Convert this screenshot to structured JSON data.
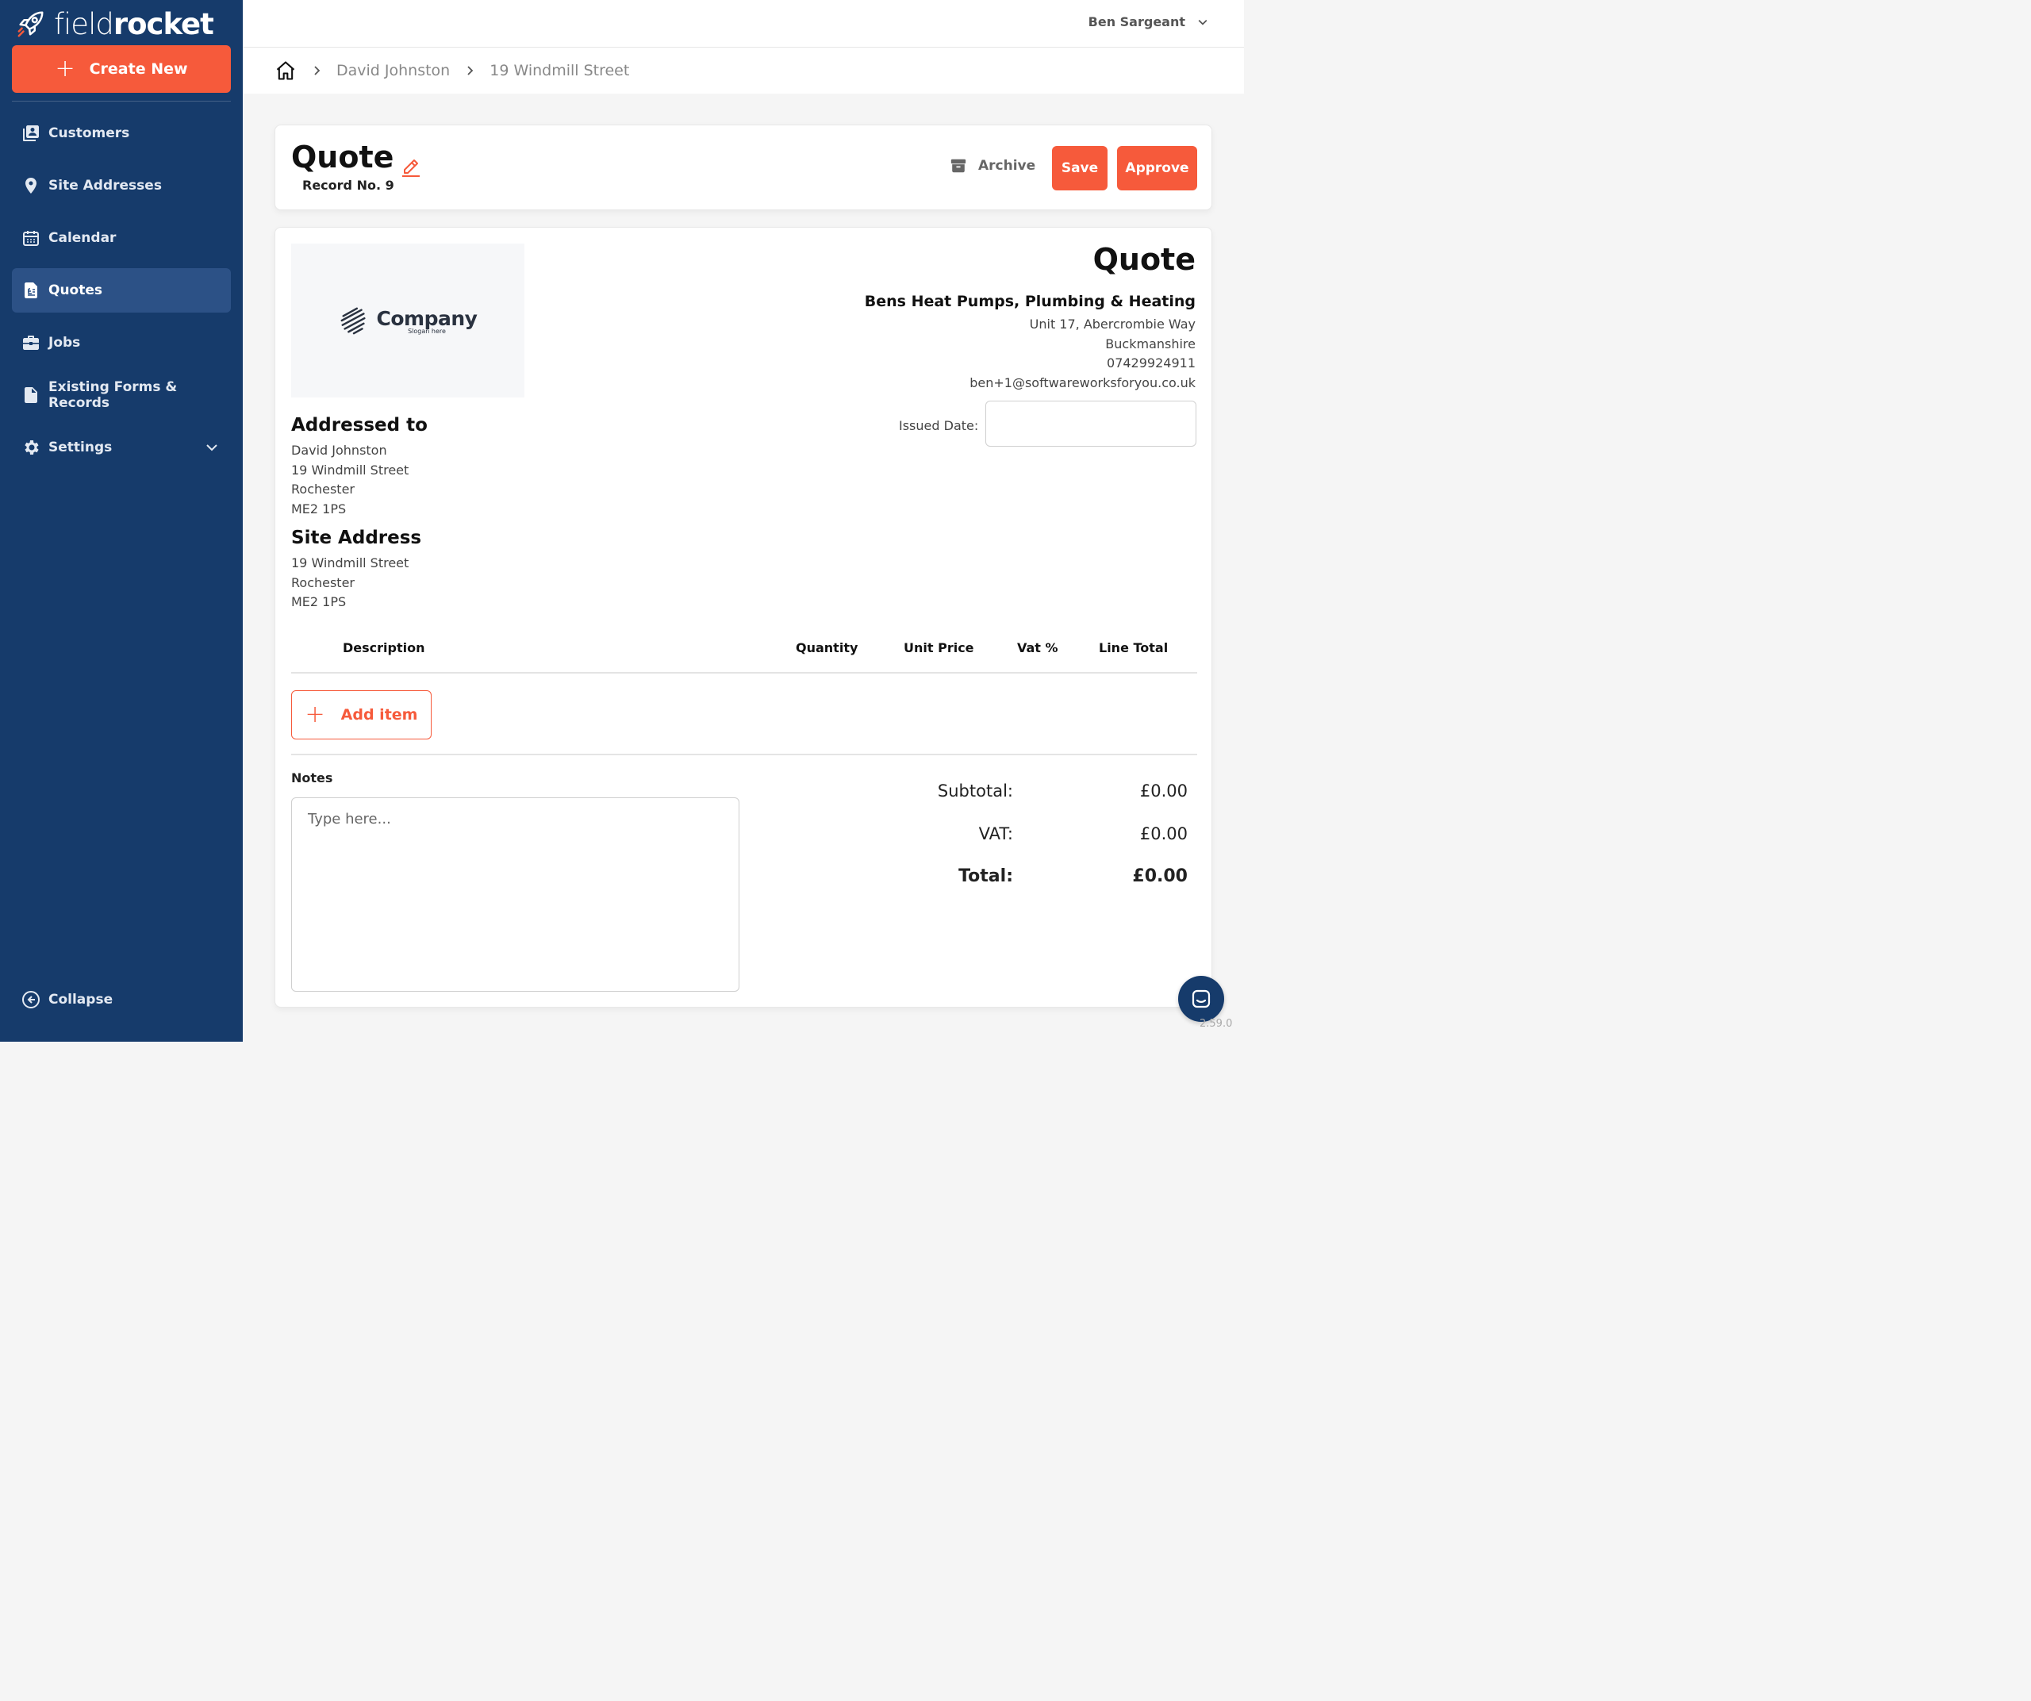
{
  "brand": {
    "light": "field",
    "bold": "rocket"
  },
  "sidebar": {
    "create_label": "Create New",
    "items": [
      {
        "label": "Customers",
        "icon": "customers-icon"
      },
      {
        "label": "Site Addresses",
        "icon": "location-pin-icon"
      },
      {
        "label": "Calendar",
        "icon": "calendar-icon"
      },
      {
        "label": "Quotes",
        "icon": "quote-document-icon",
        "active": true
      },
      {
        "label": "Jobs",
        "icon": "briefcase-icon"
      },
      {
        "label": "Existing Forms & Records",
        "icon": "file-icon"
      },
      {
        "label": "Settings",
        "icon": "gear-icon"
      }
    ],
    "collapse_label": "Collapse"
  },
  "header": {
    "user_name": "Ben Sargeant"
  },
  "breadcrumb": [
    "David Johnston",
    "19 Windmill Street"
  ],
  "quote_header": {
    "title": "Quote",
    "record": "Record No. 9",
    "archive_label": "Archive",
    "save_label": "Save",
    "approve_label": "Approve"
  },
  "document": {
    "logo": {
      "name": "Company",
      "slogan": "Slogan here"
    },
    "title": "Quote",
    "business": {
      "name": "Bens Heat Pumps, Plumbing & Heating",
      "line1": "Unit 17, Abercrombie Way",
      "line2": "Buckmanshire",
      "phone": "07429924911",
      "email": "ben+1@softwareworksforyou.co.uk"
    },
    "issued_date_label": "Issued Date:",
    "issued_date_value": "",
    "addressed_to": {
      "title": "Addressed to",
      "lines": [
        "David Johnston",
        "19 Windmill Street",
        "Rochester",
        "ME2 1PS"
      ]
    },
    "site_address": {
      "title": "Site Address",
      "lines": [
        "19 Windmill Street",
        "Rochester",
        "ME2 1PS"
      ]
    },
    "table_headers": {
      "description": "Description",
      "quantity": "Quantity",
      "unit_price": "Unit Price",
      "vat": "Vat %",
      "line_total": "Line Total"
    },
    "add_item_label": "Add item",
    "notes_label": "Notes",
    "notes_placeholder": "Type here...",
    "totals": {
      "subtotal_label": "Subtotal:",
      "subtotal": "£0.00",
      "vat_label": "VAT:",
      "vat": "£0.00",
      "total_label": "Total:",
      "total": "£0.00"
    }
  },
  "version": "2.59.0",
  "colors": {
    "sidebar": "#163b6b",
    "accent": "#f65a3b",
    "active": "#2c5186"
  }
}
